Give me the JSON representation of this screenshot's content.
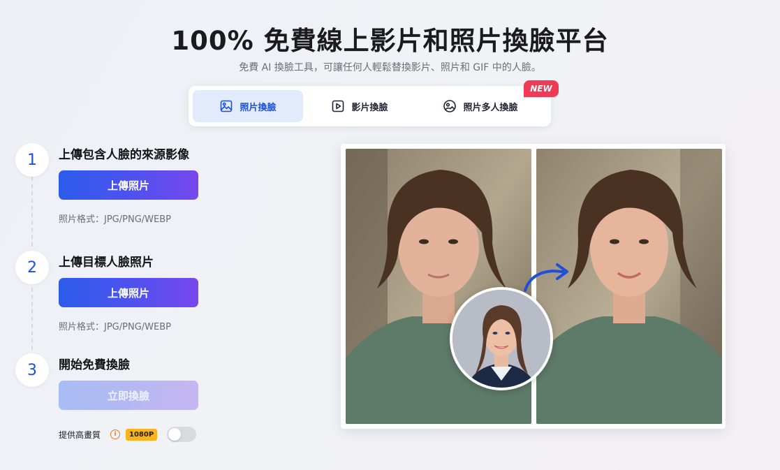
{
  "hero": {
    "title": "100% 免費線上影片和照片換臉平台",
    "subtitle": "免費 AI 換臉工具，可讓任何人輕鬆替換影片、照片和 GIF 中的人臉。"
  },
  "tabs": [
    {
      "label": "照片換臉",
      "icon": "image-icon",
      "active": true
    },
    {
      "label": "影片換臉",
      "icon": "play-icon",
      "active": false
    },
    {
      "label": "照片多人換臉",
      "icon": "multi-face-icon",
      "active": false
    }
  ],
  "new_badge": "NEW",
  "steps": [
    {
      "number": "1",
      "title": "上傳包含人臉的來源影像",
      "button": "上傳照片",
      "format": "照片格式：JPG/PNG/WEBP"
    },
    {
      "number": "2",
      "title": "上傳目標人臉照片",
      "button": "上傳照片",
      "format": "照片格式：JPG/PNG/WEBP"
    },
    {
      "number": "3",
      "title": "開始免費換臉",
      "button": "立即換臉"
    }
  ],
  "hq": {
    "label": "提供高畫質",
    "info_icon": "info-icon",
    "info_glyph": "i",
    "badge": "1080P",
    "toggle_on": false
  },
  "colors": {
    "accent": "#1d4fd8",
    "new_badge": "#ef3a56",
    "quality_badge": "#f7b51b"
  }
}
